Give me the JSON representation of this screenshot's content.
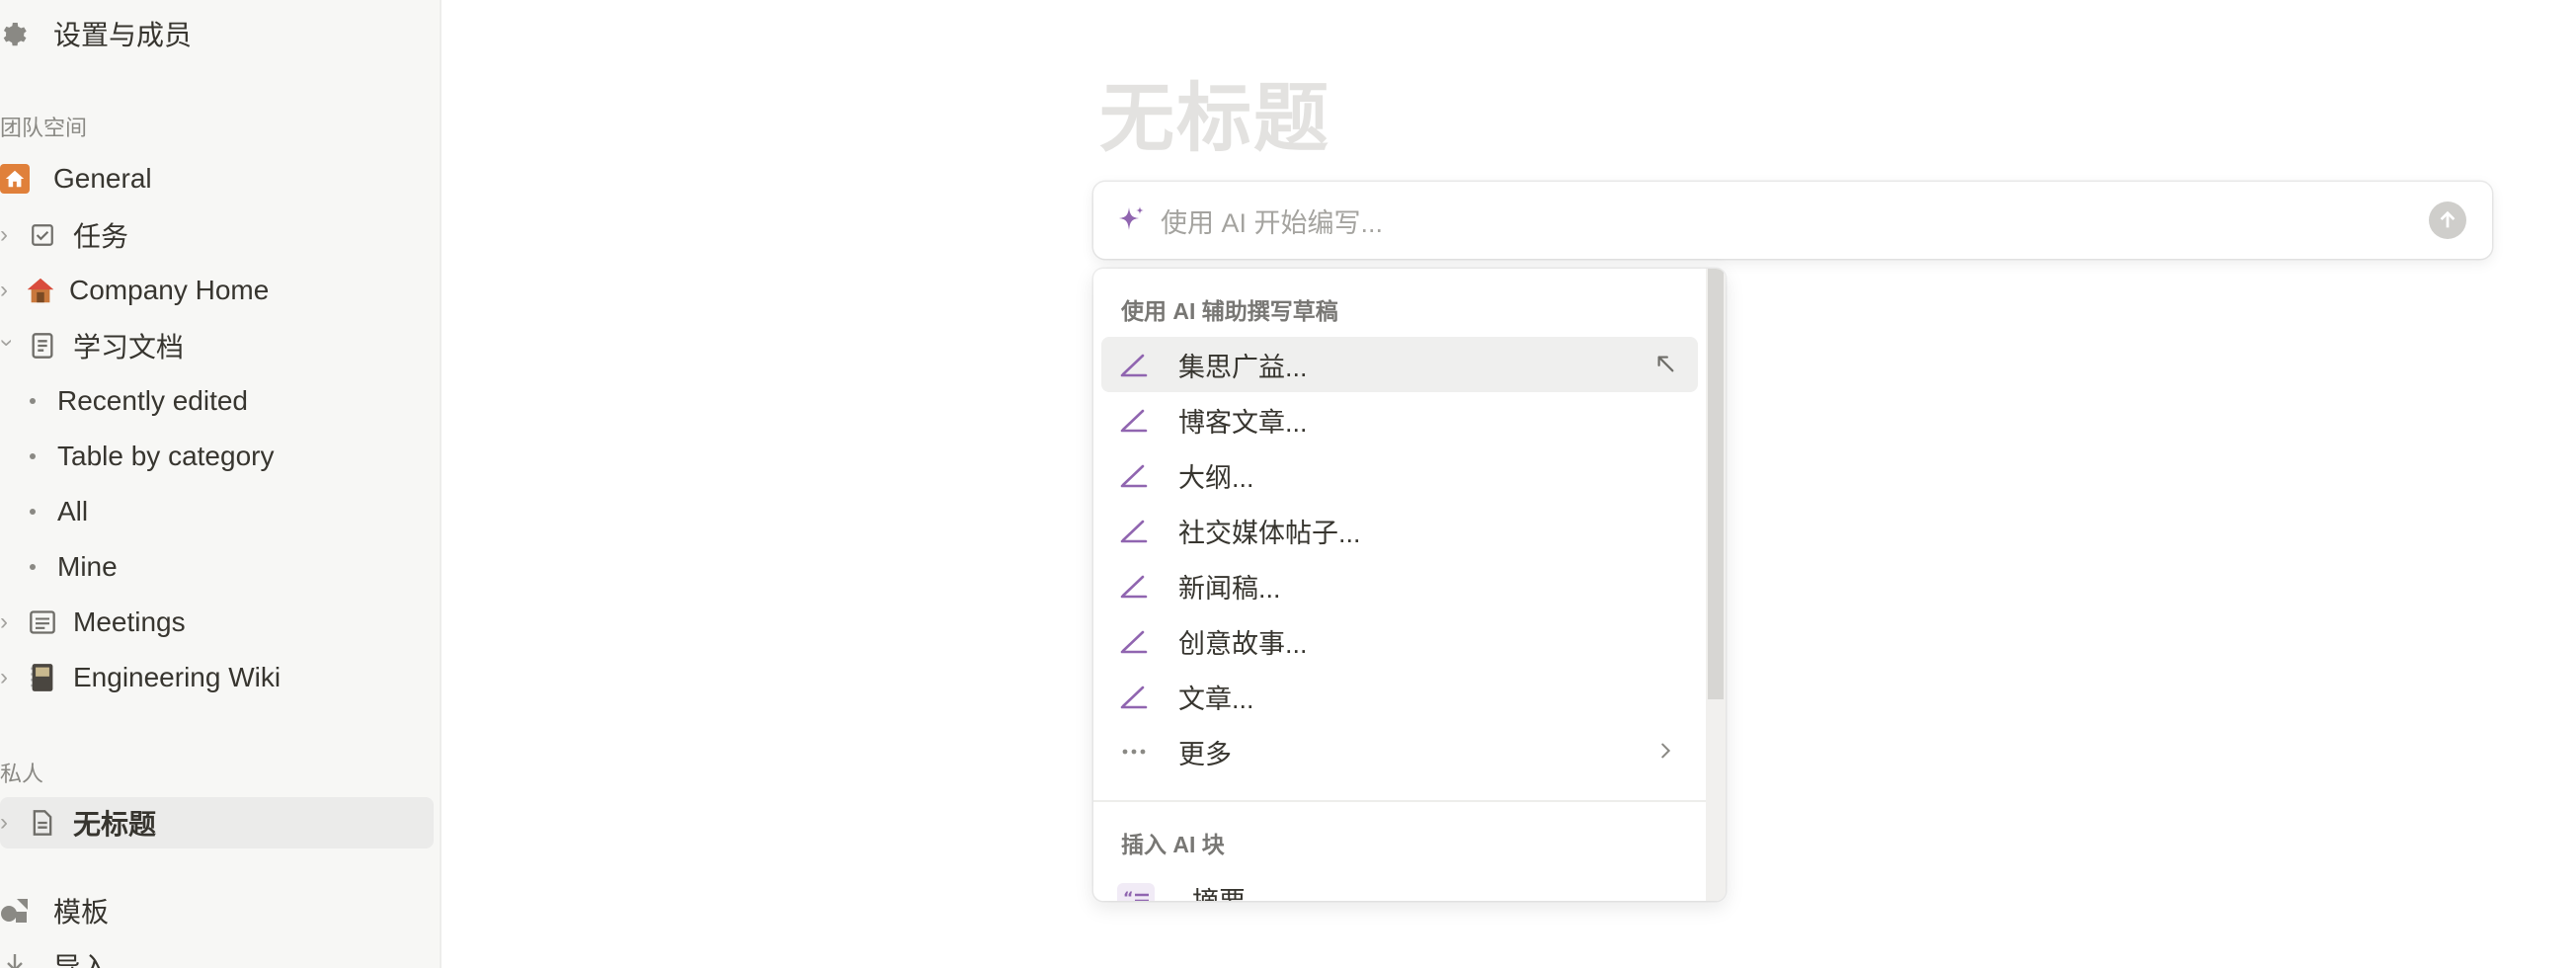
{
  "sidebar": {
    "settings": "设置与成员",
    "teamspace_header": "团队空间",
    "general": "General",
    "tasks": "任务",
    "company_home": "Company Home",
    "learning_docs": "学习文档",
    "recently_edited": "Recently edited",
    "table_by_category": "Table by category",
    "all": "All",
    "mine": "Mine",
    "meetings": "Meetings",
    "engineering_wiki": "Engineering Wiki",
    "private_header": "私人",
    "untitled": "无标题",
    "templates": "模板",
    "import": "导入"
  },
  "page": {
    "title_placeholder": "无标题"
  },
  "ai": {
    "input_placeholder": "使用 AI 开始编写...",
    "draft_header": "使用 AI 辅助撰写草稿",
    "items": [
      "集思广益...",
      "博客文章...",
      "大纲...",
      "社交媒体帖子...",
      "新闻稿...",
      "创意故事...",
      "文章..."
    ],
    "more": "更多",
    "insert_header": "插入 AI 块",
    "summary": "摘要"
  },
  "colors": {
    "accent_purple": "#9065b0",
    "home_orange": "#e0803a"
  }
}
